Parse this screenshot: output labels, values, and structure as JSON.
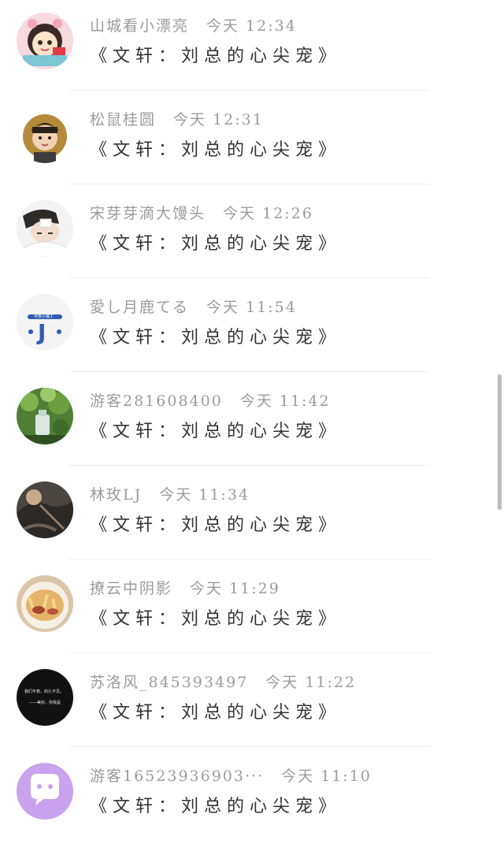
{
  "comments": [
    {
      "name": "山城看小漂亮",
      "time": "今天 12:34",
      "message": "《文轩：刘总的心尖宠》",
      "avatar_icon": "avatar-cartoon-girl"
    },
    {
      "name": "松鼠桂圆",
      "time": "今天 12:31",
      "message": "《文轩：刘总的心尖宠》",
      "avatar_icon": "avatar-boy-portrait"
    },
    {
      "name": "宋芽芽滴大馒头",
      "time": "今天 12:26",
      "message": "《文轩：刘总的心尖宠》",
      "avatar_icon": "avatar-sleeping-boy"
    },
    {
      "name": "愛し月鹿てる",
      "time": "今天 11:54",
      "message": "《文轩：刘总的心尖宠》",
      "avatar_icon": "avatar-blue-letter-j"
    },
    {
      "name": "游客281608400",
      "time": "今天 11:42",
      "message": "《文轩：刘总的心尖宠》",
      "avatar_icon": "avatar-plants-bottle"
    },
    {
      "name": "林玫LJ",
      "time": "今天 11:34",
      "message": "《文轩：刘总的心尖宠》",
      "avatar_icon": "avatar-dark-scene"
    },
    {
      "name": "撩云中阴影",
      "time": "今天 11:29",
      "message": "《文轩：刘总的心尖宠》",
      "avatar_icon": "avatar-food-bowl"
    },
    {
      "name": "苏洛风_845393497",
      "time": "今天 11:22",
      "message": "《文轩：刘总的心尖宠》",
      "avatar_icon": "avatar-black-text"
    },
    {
      "name": "游客16523936903···",
      "time": "今天 11:10",
      "message": "《文轩：刘总的心尖宠》",
      "avatar_icon": "avatar-purple-chat-bubble"
    }
  ],
  "avatar_text": {
    "blue_letter": "J",
    "blue_caption": "半部小橘丁",
    "black_line1": "我们不表，的久不见。",
    "black_line2": "——美好，你我是"
  },
  "colors": {
    "name_text": "#9b9b9b",
    "message_text": "#333333",
    "divider": "#eeeeee",
    "scrollbar": "#bdbdbd",
    "purple_avatar": "#c9a3ee"
  }
}
